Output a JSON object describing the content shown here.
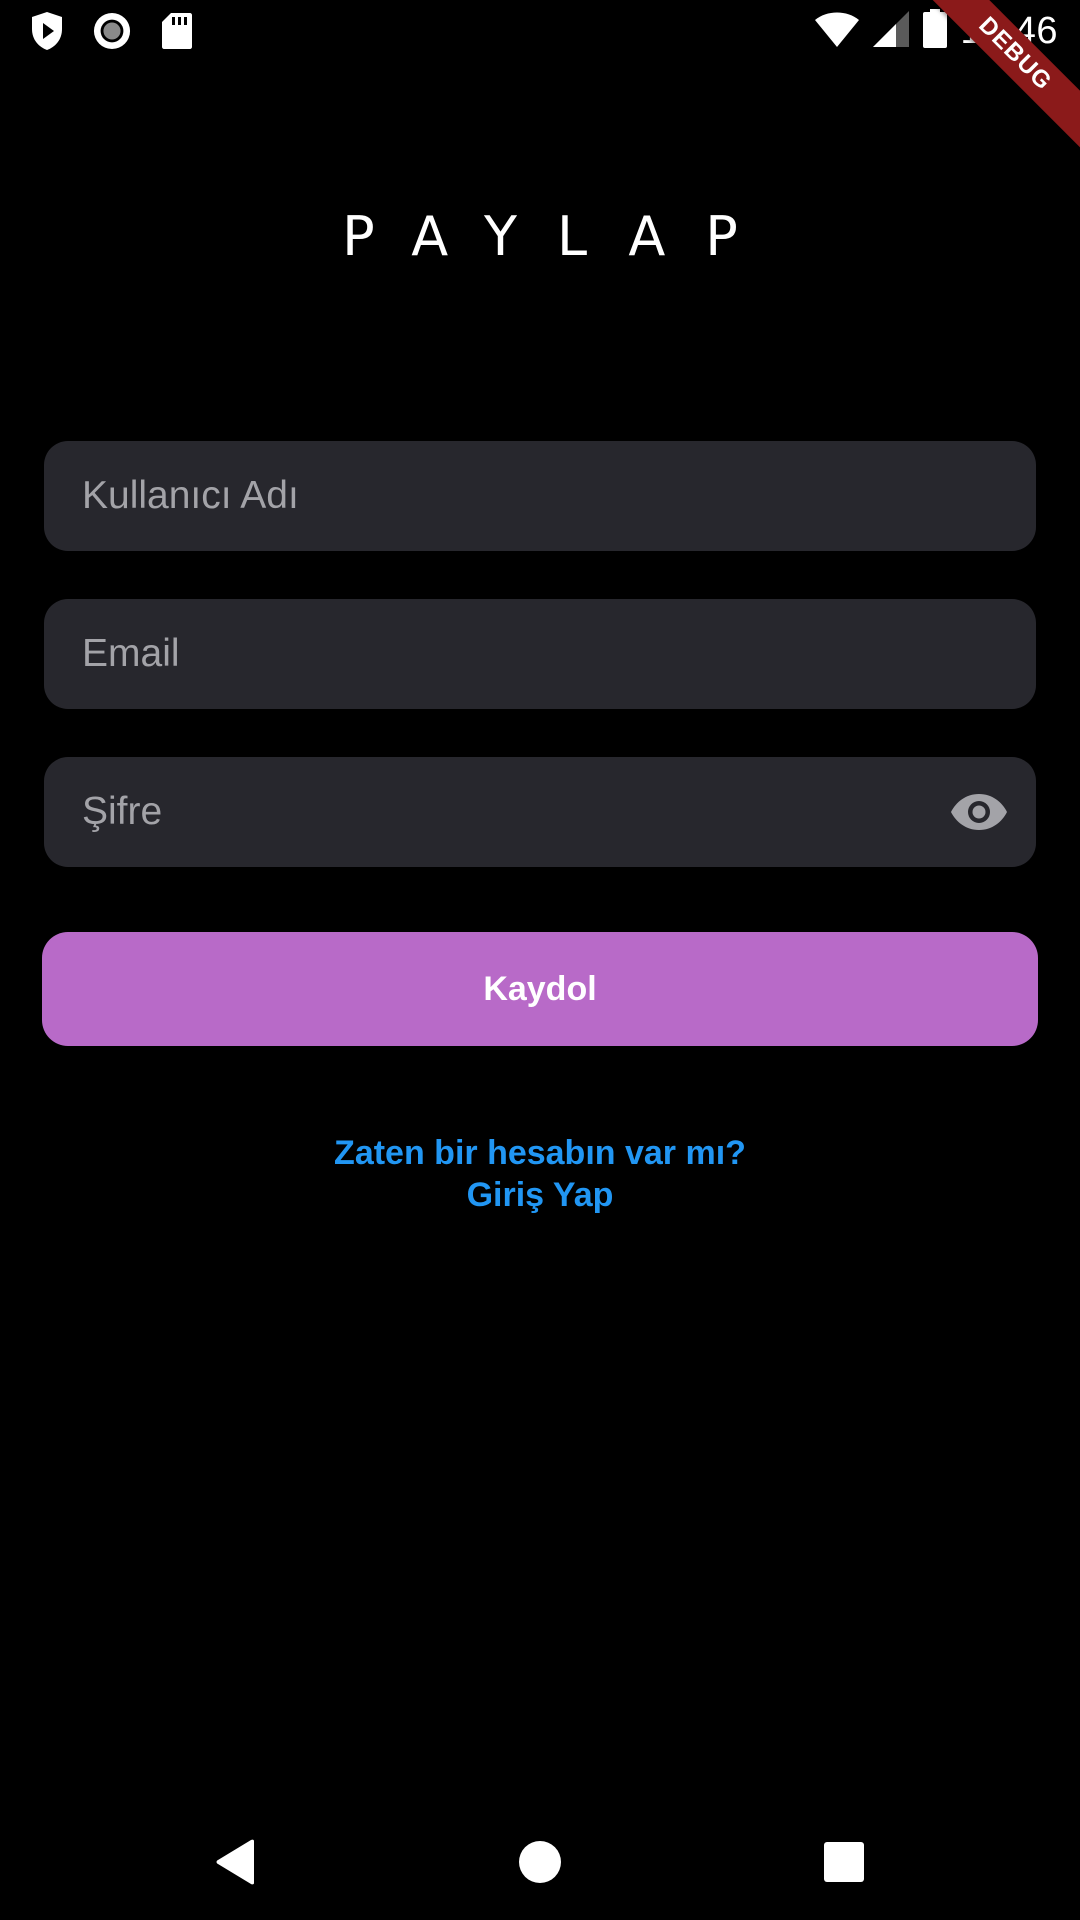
{
  "status_bar": {
    "time": "10:46",
    "icons": [
      "shield-play-icon",
      "record-icon",
      "sd-card-icon",
      "wifi-icon",
      "signal-icon",
      "battery-icon"
    ]
  },
  "debug_banner": {
    "label": "DEBUG",
    "color": "#8b1a1a"
  },
  "app": {
    "title": "PAYLAP"
  },
  "form": {
    "username": {
      "placeholder": "Kullanıcı Adı",
      "value": ""
    },
    "email": {
      "placeholder": "Email",
      "value": ""
    },
    "password": {
      "placeholder": "Şifre",
      "value": "",
      "toggle_icon": "eye-icon"
    },
    "submit_label": "Kaydol",
    "login_prompt": "Zaten bir hesabın var mı?",
    "login_action": "Giriş Yap"
  },
  "colors": {
    "background": "#000000",
    "field_background": "#27272d",
    "primary_button": "#b86ac8",
    "link": "#2196f3",
    "placeholder": "#a3a3a8"
  },
  "nav_bar": {
    "icons": [
      "back-icon",
      "home-icon",
      "recents-icon"
    ]
  }
}
